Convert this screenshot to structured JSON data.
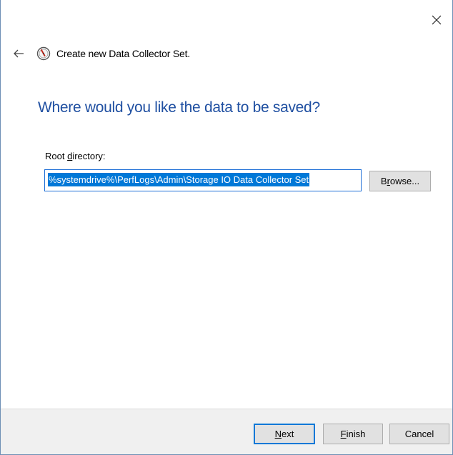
{
  "window": {
    "wizard_title": "Create new Data Collector Set."
  },
  "page": {
    "question": "Where would you like the data to be saved?",
    "root_label_prefix": "Root ",
    "root_label_accel": "d",
    "root_label_suffix": "irectory:",
    "root_directory_value": "%systemdrive%\\PerfLogs\\Admin\\Storage IO Data Collector Set",
    "browse_accel": "r",
    "browse_prefix": "B",
    "browse_suffix": "owse..."
  },
  "footer": {
    "next_accel": "N",
    "next_rest": "ext",
    "finish_accel": "F",
    "finish_rest": "inish",
    "cancel_label": "Cancel"
  },
  "colors": {
    "accent": "#0078d7",
    "heading": "#1f4fa1",
    "footer_bg": "#f0f0f0"
  },
  "icons": {
    "close": "close-icon",
    "back": "back-arrow-icon",
    "app": "performance-monitor-icon"
  }
}
